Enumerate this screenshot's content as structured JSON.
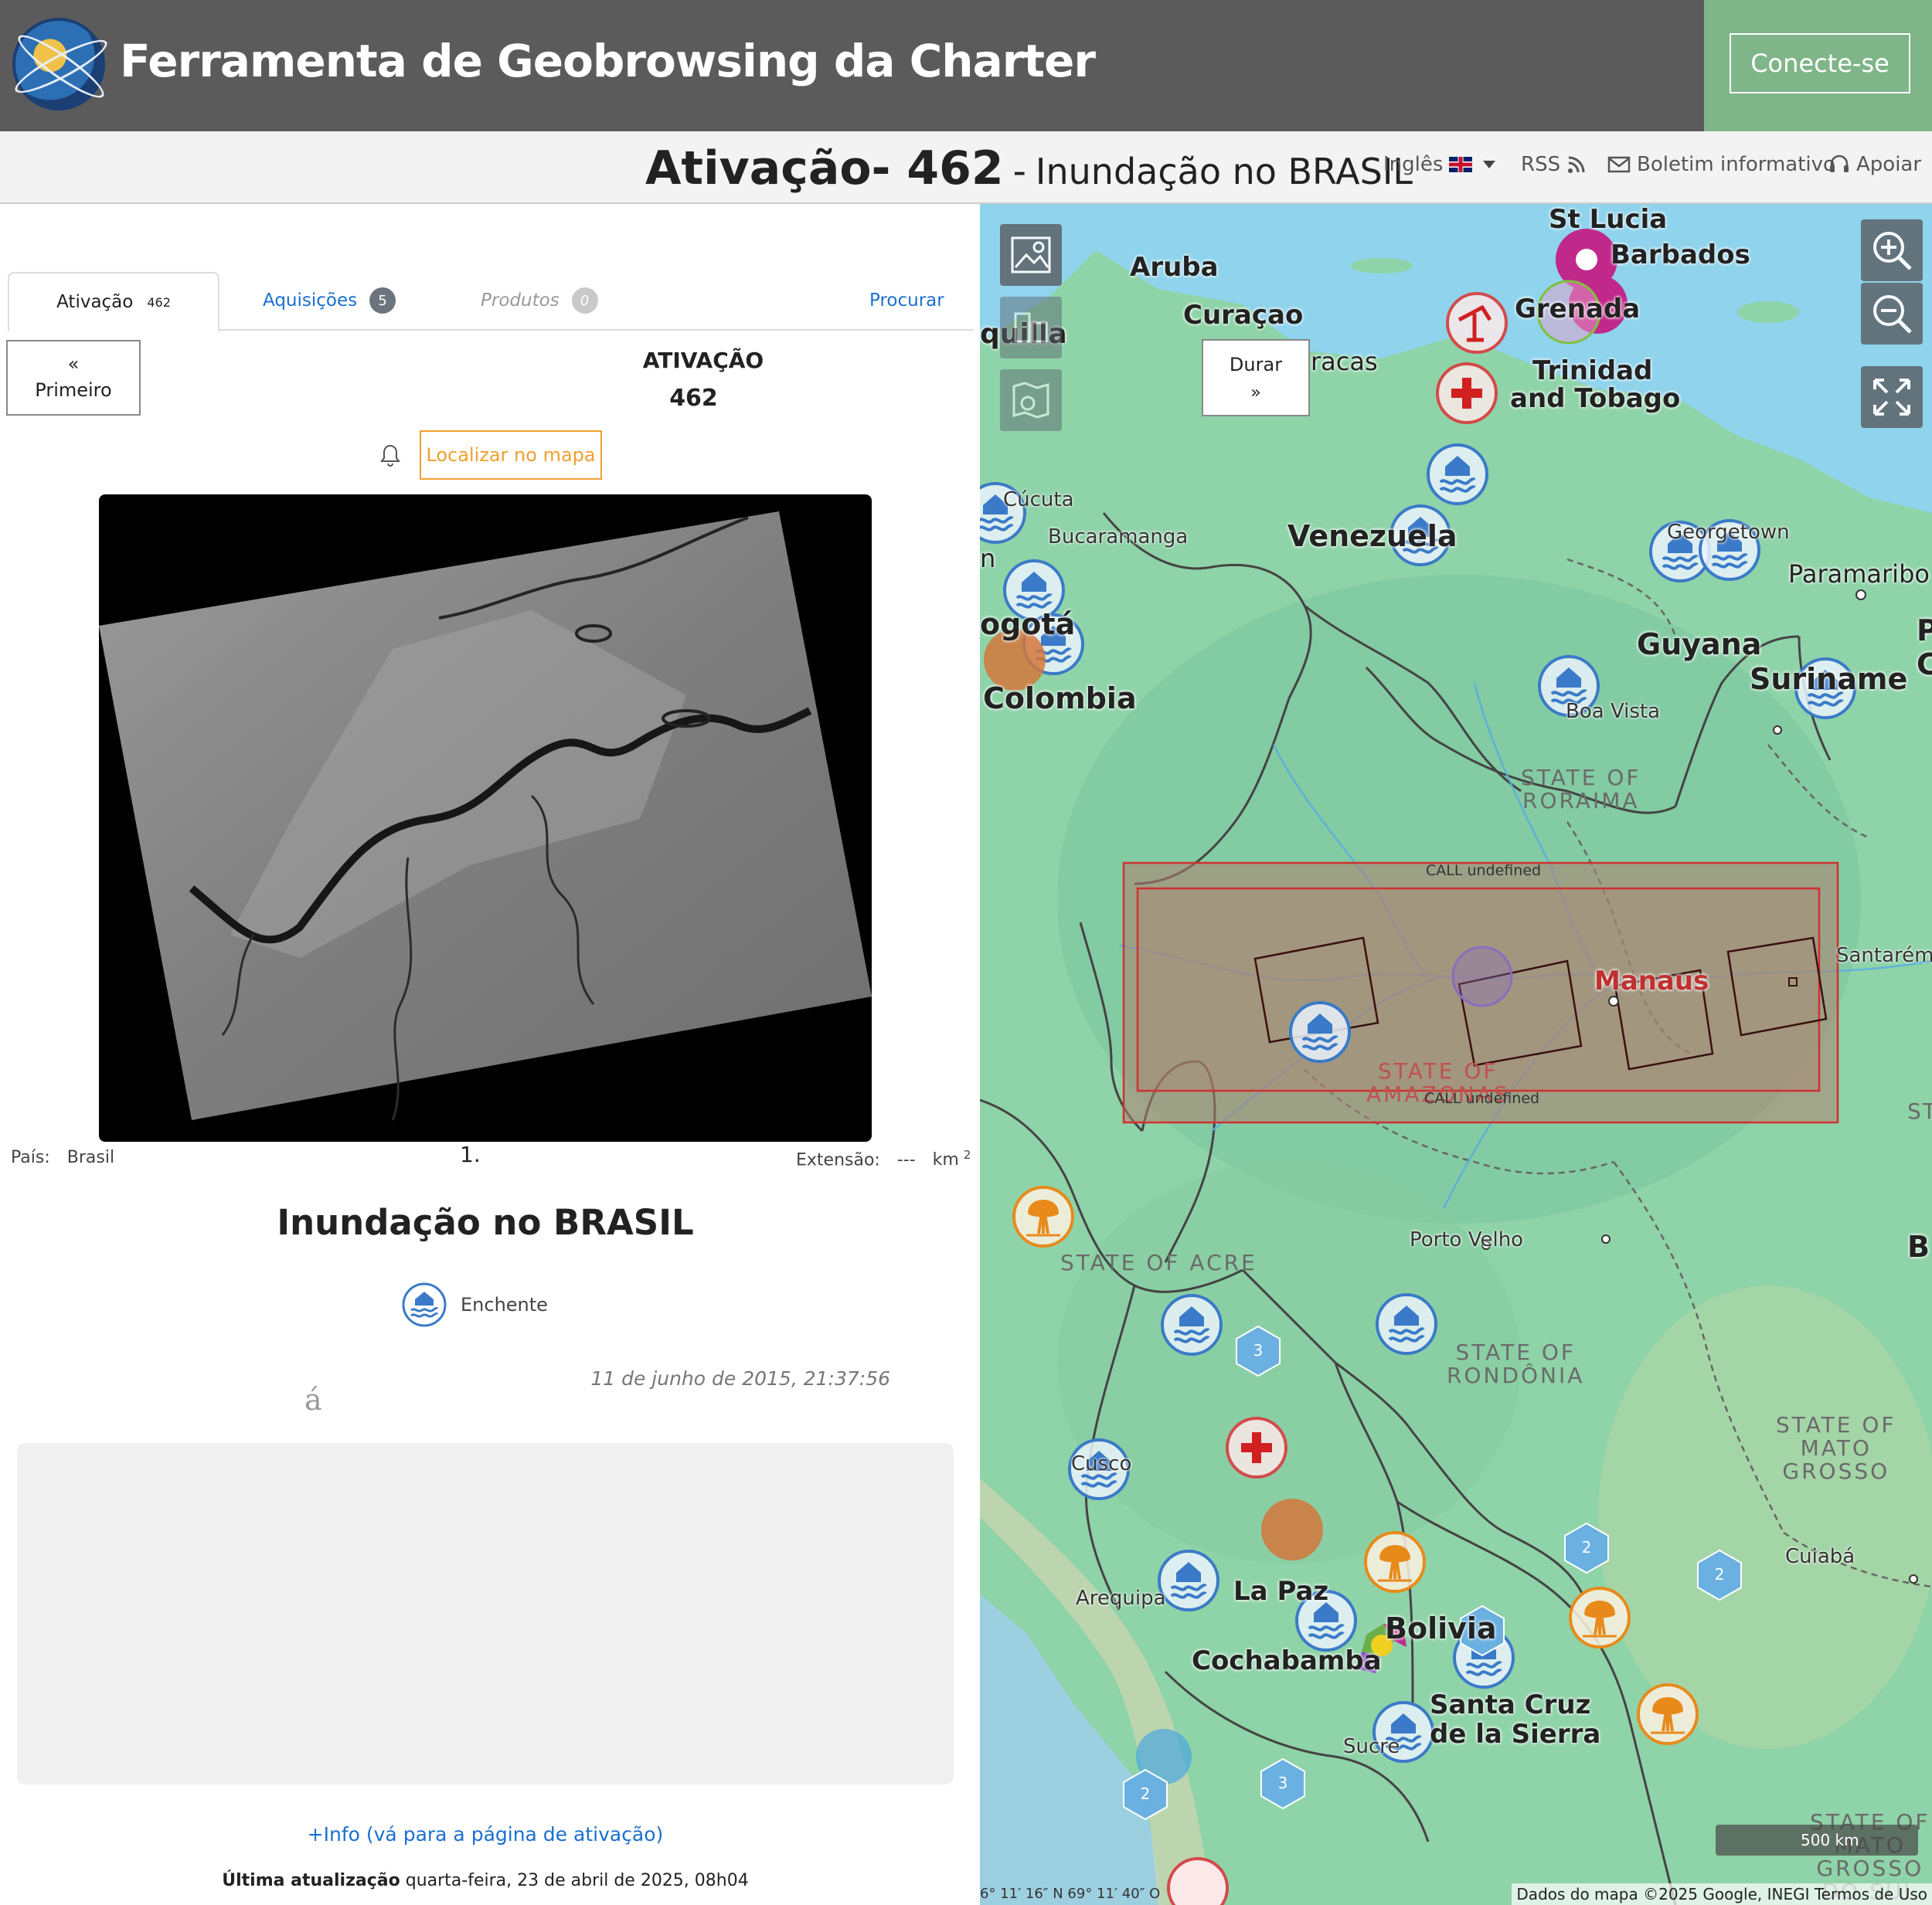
{
  "header": {
    "app_title": "Ferramenta de Geobrowsing da Charter",
    "connect_label": "Conecte-se"
  },
  "subheader": {
    "activation_label": "Ativação- 462",
    "separator": "-",
    "event_name": "Inundação no BRASIL",
    "language_label": "Inglês",
    "rss_label": "RSS",
    "newsletter_label": "Boletim informativo",
    "support_label": "Apoiar"
  },
  "tabs": {
    "activation": {
      "label": "Ativação",
      "badge": "462"
    },
    "acquisitions": {
      "label": "Aquisições",
      "badge": "5"
    },
    "products": {
      "label": "Produtos",
      "badge": "0"
    },
    "search_label": "Procurar"
  },
  "panel": {
    "first_label": "Primeiro",
    "heading": "ATIVAÇÃO",
    "number": "462",
    "locate_label": "Localizar no mapa",
    "country_key": "País:",
    "country_val": "Brasil",
    "index_label": "1.",
    "extent_key": "Extensão:",
    "extent_val": "---",
    "extent_unit": "km",
    "extent_sup": "2",
    "event_title": "Inundação no BRASIL",
    "event_type": "Enchente",
    "date": "11 de junho de 2015, 21:37:56",
    "stray_char": "á",
    "more_info": "+Info (vá para a página de ativação)",
    "last_update_key": "Última atualização",
    "last_update_val": "quarta-feira, 23 de abril de 2025, 08h04"
  },
  "map": {
    "durar_label": "Durar",
    "labels": {
      "st_lucia": "St Lucia",
      "barbados": "Barbados",
      "aruba": "Aruba",
      "curacao": "Curaçao",
      "grenada": "Grenada",
      "trinidad": "Trinidad",
      "tobago": "and Tobago",
      "caracas": "racas",
      "cucuta": "Cúcuta",
      "bucaramanga": "Bucaramanga",
      "venezuela": "Venezuela",
      "georgetown": "Georgetown",
      "paramaribo": "Paramaribo",
      "guyana": "Guyana",
      "suriname": "Suriname",
      "bogota": "ogotá",
      "colombia": "Colombia",
      "boa_vista": "Boa Vista",
      "roraima": "STATE OF\nRORAIMA",
      "manaus": "Manaus",
      "amazonas": "STATE OF\nAMAZONAS",
      "santarem": "Santarém",
      "porto_velho": "Porto Velho",
      "acre": "STATE OF ACRE",
      "rondonia": "STATE OF\nRONDÔNIA",
      "mato_grosso": "STATE OF\nMATO\nGROSSO",
      "cuiaba": "Cuiabá",
      "cusco": "Cusco",
      "arequipa": "Arequipa",
      "la_paz": "La Paz",
      "bolivia": "Bolivia",
      "cochabamba": "Cochabamba",
      "santa_cruz": "Santa Cruz\nde la Sierra",
      "sucre": "Sucre",
      "ms": "STATE OF\nMATO\nGROSSO\nDO SUL",
      "call_top": "CALL undefined",
      "call_bottom": "CALL undefined",
      "quilla": "quilla",
      "n_edge": "n",
      "p_edge": "P",
      "c_edge": "C",
      "b_edge": "B",
      "sta_edge": "STA"
    },
    "cluster_counts": [
      "3",
      "3",
      "2",
      "2",
      "2",
      "2"
    ],
    "scale_label": "500 km",
    "coords": "6° 11′ 16″ N 69° 11′ 40″ O",
    "attribution": "Dados do mapa ©2025 Google, INEGI  Termos de Uso"
  },
  "colors": {
    "header_bg": "#5b5b5b",
    "connect_bg": "#7fb589",
    "link_blue": "#1a6fd0",
    "locate_orange": "#f0a030",
    "flood_blue": "#3a7ac8",
    "fire_orange": "#e88a1a",
    "aoi_red": "#d03030"
  }
}
